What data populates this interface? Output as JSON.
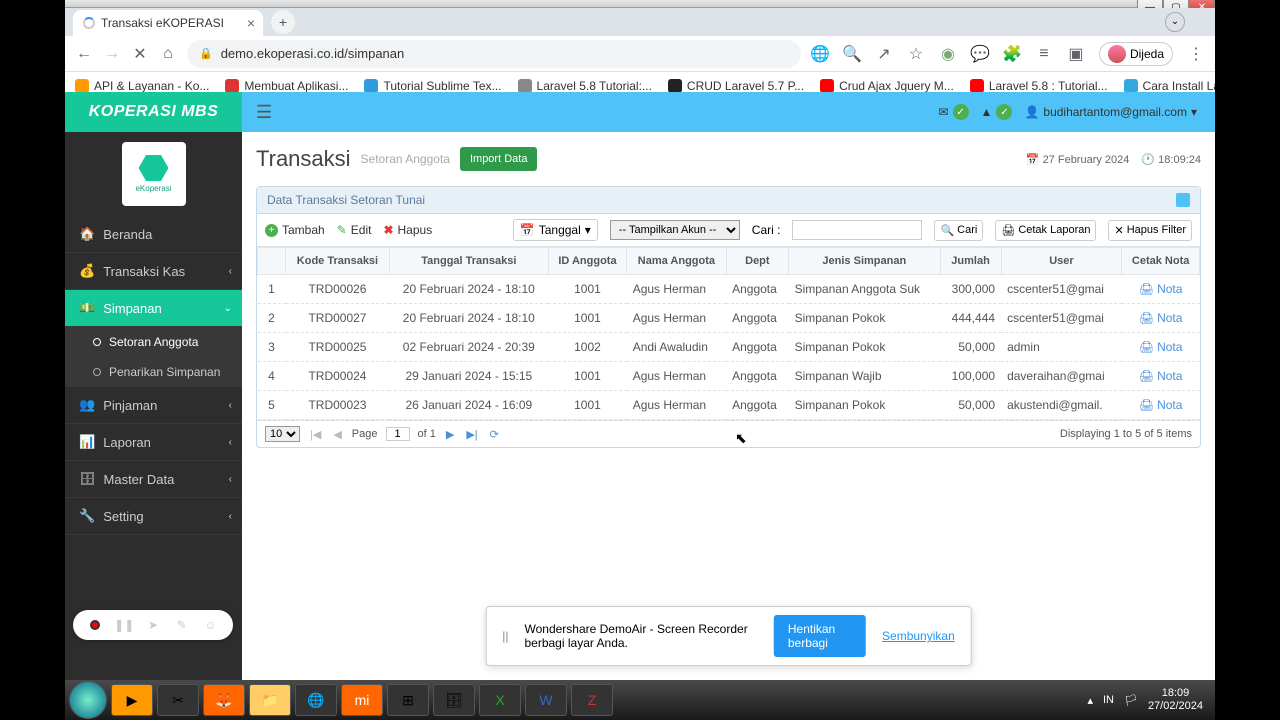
{
  "browser": {
    "tab_title": "Transaksi eKOPERASI",
    "url": "demo.ekoperasi.co.id/simpanan",
    "profile_name": "Dijeda",
    "bookmarks": [
      {
        "label": "API & Layanan - Ko...",
        "color": "#f90"
      },
      {
        "label": "Membuat Aplikasi...",
        "color": "#d33"
      },
      {
        "label": "Tutorial Sublime Tex...",
        "color": "#39d"
      },
      {
        "label": "Laravel 5.8 Tutorial:...",
        "color": "#888"
      },
      {
        "label": "CRUD Laravel 5.7 P...",
        "color": "#222"
      },
      {
        "label": "Crud Ajax Jquery M...",
        "color": "#f00"
      },
      {
        "label": "Laravel 5.8 : Tutorial...",
        "color": "#f00"
      },
      {
        "label": "Cara Install Laravel...",
        "color": "#3ad"
      }
    ]
  },
  "header": {
    "brand": "KOPERASI MBS",
    "user_email": "budihartantom@gmail.com",
    "logo_text": "eKoperasi"
  },
  "sidebar": {
    "items": [
      {
        "label": "Beranda",
        "icon": "home"
      },
      {
        "label": "Transaksi Kas",
        "icon": "wallet",
        "expand": true
      },
      {
        "label": "Simpanan",
        "icon": "savings",
        "expand": true,
        "active": true
      },
      {
        "label": "Pinjaman",
        "icon": "loan",
        "expand": true
      },
      {
        "label": "Laporan",
        "icon": "report",
        "expand": true
      },
      {
        "label": "Master Data",
        "icon": "db",
        "expand": true
      },
      {
        "label": "Setting",
        "icon": "wrench",
        "expand": true
      }
    ],
    "sub_simpanan": [
      {
        "label": "Setoran Anggota",
        "active": true
      },
      {
        "label": "Penarikan Simpanan"
      }
    ]
  },
  "page": {
    "title": "Transaksi",
    "subtitle": "Setoran Anggota",
    "import_btn": "Import Data",
    "date": "27 February 2024",
    "time": "18:09:24",
    "panel_title": "Data Transaksi Setoran Tunai"
  },
  "toolbar": {
    "add": "Tambah",
    "edit": "Edit",
    "delete": "Hapus",
    "date_filter": "Tanggal",
    "account_select": "-- Tampilkan Akun --",
    "search_label": "Cari :",
    "search_btn": "Cari",
    "print_btn": "Cetak Laporan",
    "clear_btn": "Hapus Filter"
  },
  "columns": [
    "",
    "Kode Transaksi",
    "Tanggal Transaksi",
    "ID Anggota",
    "Nama Anggota",
    "Dept",
    "Jenis Simpanan",
    "Jumlah",
    "User",
    "Cetak Nota"
  ],
  "rows": [
    {
      "n": "1",
      "kode": "TRD00026",
      "tgl": "20 Februari 2024 - 18:10",
      "id": "1001",
      "nama": "Agus Herman",
      "dept": "Anggota",
      "jenis": "Simpanan Anggota Suk",
      "jml": "300,000",
      "user": "cscenter51@gmai"
    },
    {
      "n": "2",
      "kode": "TRD00027",
      "tgl": "20 Februari 2024 - 18:10",
      "id": "1001",
      "nama": "Agus Herman",
      "dept": "Anggota",
      "jenis": "Simpanan Pokok",
      "jml": "444,444",
      "user": "cscenter51@gmai"
    },
    {
      "n": "3",
      "kode": "TRD00025",
      "tgl": "02 Februari 2024 - 20:39",
      "id": "1002",
      "nama": "Andi Awaludin",
      "dept": "Anggota",
      "jenis": "Simpanan Pokok",
      "jml": "50,000",
      "user": "admin"
    },
    {
      "n": "4",
      "kode": "TRD00024",
      "tgl": "29 Januari 2024 - 15:15",
      "id": "1001",
      "nama": "Agus Herman",
      "dept": "Anggota",
      "jenis": "Simpanan Wajib",
      "jml": "100,000",
      "user": "daveraihan@gmai"
    },
    {
      "n": "5",
      "kode": "TRD00023",
      "tgl": "26 Januari 2024 - 16:09",
      "id": "1001",
      "nama": "Agus Herman",
      "dept": "Anggota",
      "jenis": "Simpanan Pokok",
      "jml": "50,000",
      "user": "akustendi@gmail."
    }
  ],
  "nota_label": "Nota",
  "pager": {
    "size": "10",
    "page_label": "Page",
    "page": "1",
    "of_label": "of 1",
    "display": "Displaying 1 to 5 of 5 items"
  },
  "share": {
    "text": "Wondershare DemoAir - Screen Recorder berbagi layar Anda.",
    "stop": "Hentikan berbagi",
    "hide": "Sembunyikan"
  },
  "taskbar": {
    "lang": "IN",
    "time": "18:09",
    "date": "27/02/2024"
  }
}
